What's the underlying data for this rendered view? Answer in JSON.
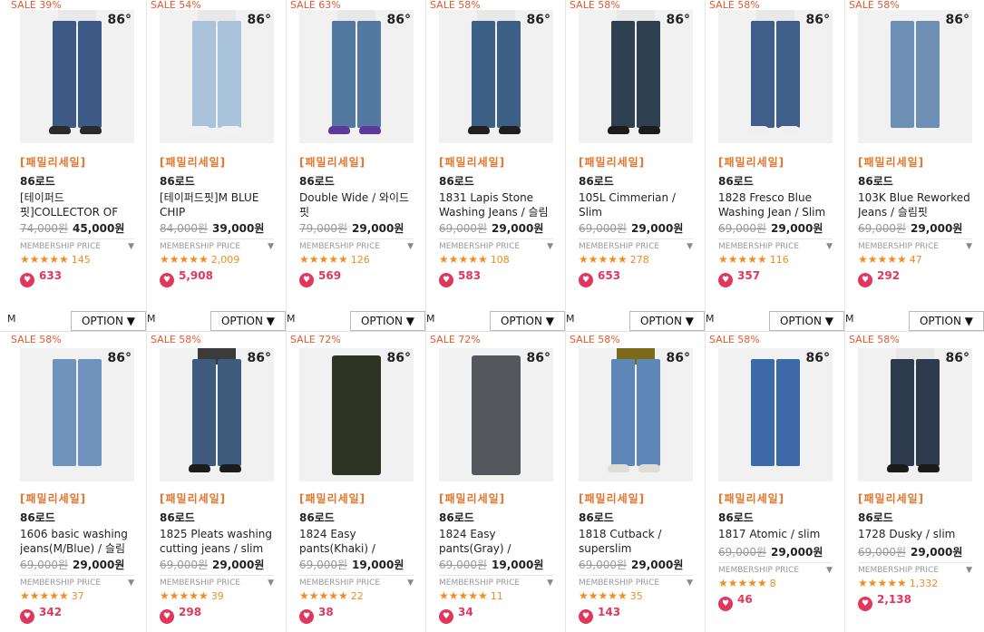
{
  "brand_logo": "86",
  "option_label": "OPTION ▼",
  "member_label": "MEMBERSHIP PRICE",
  "member_arrow": "▼",
  "products": [
    {
      "sale": "SALE 39%",
      "promo": "[패밀리세일]",
      "brand": "86로드",
      "name": "[테이퍼드 핏]COLLECTOR OF",
      "orig_price": "74,000원",
      "price": "45,000원",
      "stars": "★★★★★",
      "rating_count": "145",
      "likes": "633",
      "size": "M",
      "denim_color": "#3d5a86",
      "shoe_color": "#2a2a2a",
      "top": "light"
    },
    {
      "sale": "SALE 54%",
      "promo": "[패밀리세일]",
      "brand": "86로드",
      "name": "[테이퍼드핏]M BLUE CHIP",
      "orig_price": "84,000원",
      "price": "39,000원",
      "stars": "★★★★★",
      "rating_count": "2,009",
      "likes": "5,908",
      "size": "M",
      "denim_color": "#a9c4da",
      "shoe_color": "#f2f2f2",
      "top": "light"
    },
    {
      "sale": "SALE 63%",
      "promo": "[패밀리세일]",
      "brand": "86로드",
      "name": "Double Wide / 와이드 핏",
      "orig_price": "79,000원",
      "price": "29,000원",
      "stars": "★★★★★",
      "rating_count": "126",
      "likes": "569",
      "size": "M",
      "denim_color": "#5379a1",
      "shoe_color": "#5b3a9a",
      "top": "light"
    },
    {
      "sale": "SALE 58%",
      "promo": "[패밀리세일]",
      "brand": "86로드",
      "name": "1831 Lapis Stone Washing Jeans / 슬림",
      "orig_price": "69,000원",
      "price": "29,000원",
      "stars": "★★★★★",
      "rating_count": "108",
      "likes": "583",
      "size": "M",
      "denim_color": "#3b5f85",
      "shoe_color": "#1f1f1f",
      "top": "light"
    },
    {
      "sale": "SALE 58%",
      "promo": "[패밀리세일]",
      "brand": "86로드",
      "name": "105L Cimmerian / Slim",
      "orig_price": "69,000원",
      "price": "29,000원",
      "stars": "★★★★★",
      "rating_count": "278",
      "likes": "653",
      "size": "M",
      "denim_color": "#2f4050",
      "shoe_color": "#1b1b1b",
      "top": "light"
    },
    {
      "sale": "SALE 58%",
      "promo": "[패밀리세일]",
      "brand": "86로드",
      "name": "1828 Fresco Blue Washing Jean / Slim",
      "orig_price": "69,000원",
      "price": "29,000원",
      "stars": "★★★★★",
      "rating_count": "116",
      "likes": "357",
      "size": "M",
      "denim_color": "#3f5f8a",
      "shoe_color": "#f0f0f0",
      "top": "light"
    },
    {
      "sale": "SALE 58%",
      "promo": "[패밀리세일]",
      "brand": "86로드",
      "name": "103K Blue Reworked Jeans / 슬림핏",
      "orig_price": "69,000원",
      "price": "29,000원",
      "stars": "★★★★★",
      "rating_count": "47",
      "likes": "292",
      "size": "M",
      "denim_color": "#6d8fb4",
      "shoe_color": "",
      "top": "none"
    },
    {
      "sale": "SALE 58%",
      "promo": "[패밀리세일]",
      "brand": "86로드",
      "name": "1606 basic washing jeans(M/Blue) / 슬림",
      "orig_price": "69,000원",
      "price": "29,000원",
      "stars": "★★★★★",
      "rating_count": "37",
      "likes": "342",
      "size": "",
      "denim_color": "#6f93bd",
      "shoe_color": "",
      "top": "none"
    },
    {
      "sale": "SALE 58%",
      "promo": "[패밀리세일]",
      "brand": "86로드",
      "name": "1825 Pleats washing cutting jeans / slim",
      "orig_price": "69,000원",
      "price": "29,000원",
      "stars": "★★★★★",
      "rating_count": "39",
      "likes": "298",
      "size": "",
      "denim_color": "#3e5b7e",
      "shoe_color": "#1c1c1c",
      "top": "dark"
    },
    {
      "sale": "SALE 72%",
      "promo": "[패밀리세일]",
      "brand": "86로드",
      "name": "1824 Easy pants(Khaki) /",
      "orig_price": "69,000원",
      "price": "19,000원",
      "stars": "★★★★★",
      "rating_count": "22",
      "likes": "38",
      "size": "",
      "denim_color": "#2f3324",
      "shoe_color": "",
      "top": "flat"
    },
    {
      "sale": "SALE 72%",
      "promo": "[패밀리세일]",
      "brand": "86로드",
      "name": "1824 Easy pants(Gray) /",
      "orig_price": "69,000원",
      "price": "19,000원",
      "stars": "★★★★★",
      "rating_count": "11",
      "likes": "34",
      "size": "",
      "denim_color": "#54575c",
      "shoe_color": "",
      "top": "flat"
    },
    {
      "sale": "SALE 58%",
      "promo": "[패밀리세일]",
      "brand": "86로드",
      "name": "1818 Cutback / superslim",
      "orig_price": "69,000원",
      "price": "29,000원",
      "stars": "★★★★★",
      "rating_count": "35",
      "likes": "143",
      "size": "",
      "denim_color": "#5e86b6",
      "shoe_color": "#e0ddd6",
      "top": "olive"
    },
    {
      "sale": "SALE 58%",
      "promo": "[패밀리세일]",
      "brand": "86로드",
      "name": "1817 Atomic / slim",
      "orig_price": "69,000원",
      "price": "29,000원",
      "stars": "★★★★★",
      "rating_count": "8",
      "likes": "46",
      "size": "",
      "denim_color": "#3d6aa6",
      "shoe_color": "",
      "top": "none"
    },
    {
      "sale": "SALE 58%",
      "promo": "[패밀리세일]",
      "brand": "86로드",
      "name": "1728 Dusky / slim",
      "orig_price": "69,000원",
      "price": "29,000원",
      "stars": "★★★★★",
      "rating_count": "1,332",
      "likes": "2,138",
      "size": "",
      "denim_color": "#2d3b4d",
      "shoe_color": "#1a1a1a",
      "top": "light"
    }
  ]
}
